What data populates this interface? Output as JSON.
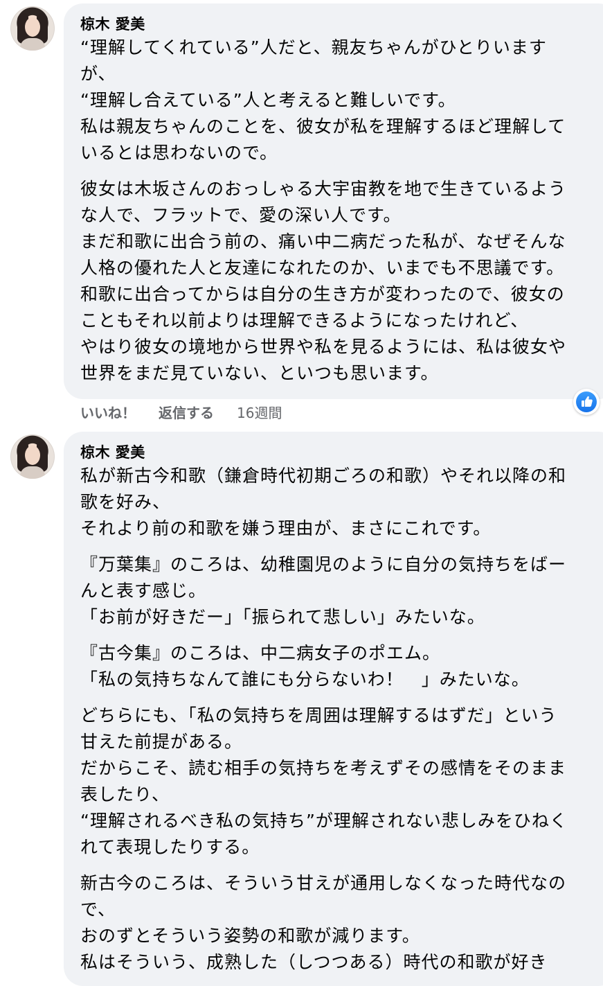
{
  "comments": [
    {
      "author": "椋木 愛美",
      "paragraphs": [
        [
          "“理解してくれている”人だと、親友ちゃんがひとりいます",
          "が、",
          "“理解し合えている”人と考えると難しいです。",
          "私は親友ちゃんのことを、彼女が私を理解するほど理解して",
          "いるとは思わないので。"
        ],
        [
          "彼女は木坂さんのおっしゃる大宇宙教を地で生きているよう",
          "な人で、フラットで、愛の深い人です。",
          "まだ和歌に出合う前の、痛い中二病だった私が、なぜそんな",
          "人格の優れた人と友達になれたのか、いまでも不思議です。",
          "和歌に出合ってからは自分の生き方が変わったので、彼女の",
          "こともそれ以前よりは理解できるようになったけれど、",
          "やはり彼女の境地から世界や私を見るようには、私は彼女や",
          "世界をまだ見ていない、といつも思います。"
        ]
      ],
      "like_label": "いいね！",
      "reply_label": "返信する",
      "time": "16週間",
      "reaction_icon": "thumbs-up-icon"
    },
    {
      "author": "椋木 愛美",
      "paragraphs": [
        [
          "私が新古今和歌（鎌倉時代初期ごろの和歌）やそれ以降の和",
          "歌を好み、",
          "それより前の和歌を嫌う理由が、まさにこれです。"
        ],
        [
          "『万葉集』のころは、幼稚園児のように自分の気持ちをばー",
          "んと表す感じ。",
          "「お前が好きだー」「振られて悲しい」みたいな。"
        ],
        [
          "『古今集』のころは、中二病女子のポエム。",
          "「私の気持ちなんて誰にも分らないわ！　」みたいな。"
        ],
        [
          "どちらにも、「私の気持ちを周囲は理解するはずだ」という",
          "甘えた前提がある。",
          "だからこそ、読む相手の気持ちを考えずその感情をそのまま",
          "表したり、",
          "“理解されるべき私の気持ち”が理解されない悲しみをひねく",
          "れて表現したりする。"
        ],
        [
          "新古今のころは、そういう甘えが通用しなくなった時代なの",
          "で、",
          "おのずとそういう姿勢の和歌が減ります。",
          "私はそういう、成熟した（しつつある）時代の和歌が好き"
        ]
      ]
    }
  ],
  "colors": {
    "bubble": "#f0f2f5",
    "meta_text": "#65676b",
    "like_blue": "#1877f2"
  }
}
